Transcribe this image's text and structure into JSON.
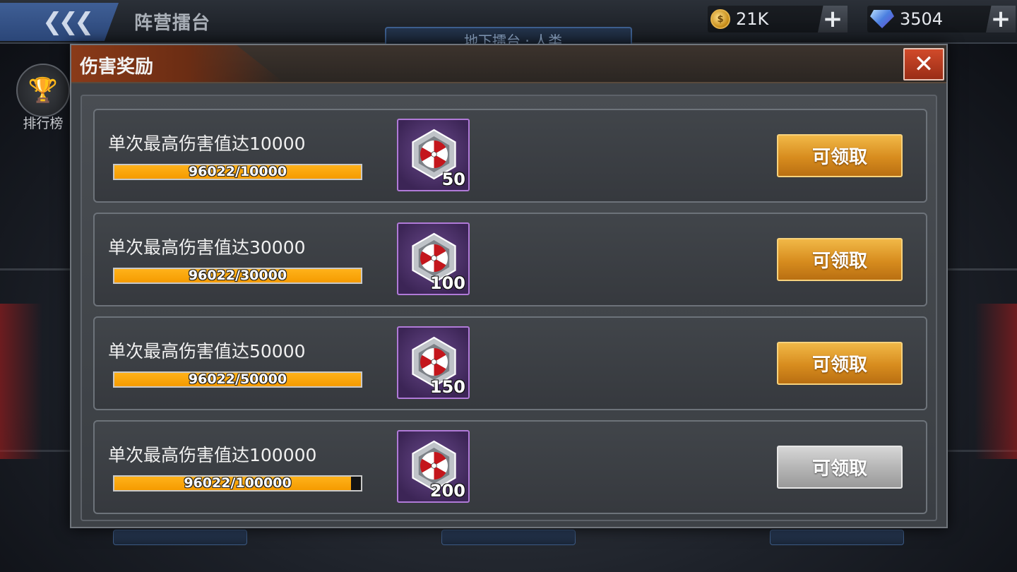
{
  "topbar": {
    "back_icon": "double-chevron-left-icon",
    "title": "阵营擂台",
    "sub_tab": "地下擂台 · 人类",
    "coins": "21K",
    "gems": "3504",
    "coin_icon": "gold-coin-icon",
    "gem_icon": "diamond-icon"
  },
  "sidebar": {
    "leaderboard_label": "排行榜",
    "leaderboard_icon": "trophy-icon"
  },
  "modal": {
    "title": "伤害奖励",
    "close_icon": "close-icon",
    "rewards": [
      {
        "desc": "单次最高伤害值达10000",
        "progress": "96022/10000",
        "progress_fraction": 1.0,
        "item_icon": "umbrella-emblem-icon",
        "count": "50",
        "button": "可领取",
        "button_state": "enabled"
      },
      {
        "desc": "单次最高伤害值达30000",
        "progress": "96022/30000",
        "progress_fraction": 1.0,
        "item_icon": "umbrella-emblem-icon",
        "count": "100",
        "button": "可领取",
        "button_state": "enabled"
      },
      {
        "desc": "单次最高伤害值达50000",
        "progress": "96022/50000",
        "progress_fraction": 1.0,
        "item_icon": "umbrella-emblem-icon",
        "count": "150",
        "button": "可领取",
        "button_state": "enabled"
      },
      {
        "desc": "单次最高伤害值达100000",
        "progress": "96022/100000",
        "progress_fraction": 0.96022,
        "item_icon": "umbrella-emblem-icon",
        "count": "200",
        "button": "可领取",
        "button_state": "disabled"
      }
    ]
  },
  "colors": {
    "claim_button": "#d78c1e",
    "claim_button_disabled": "#b3b3b3",
    "progress_fill": "#f59b00",
    "item_border": "#b07ad8",
    "close_button": "#c0401f"
  }
}
